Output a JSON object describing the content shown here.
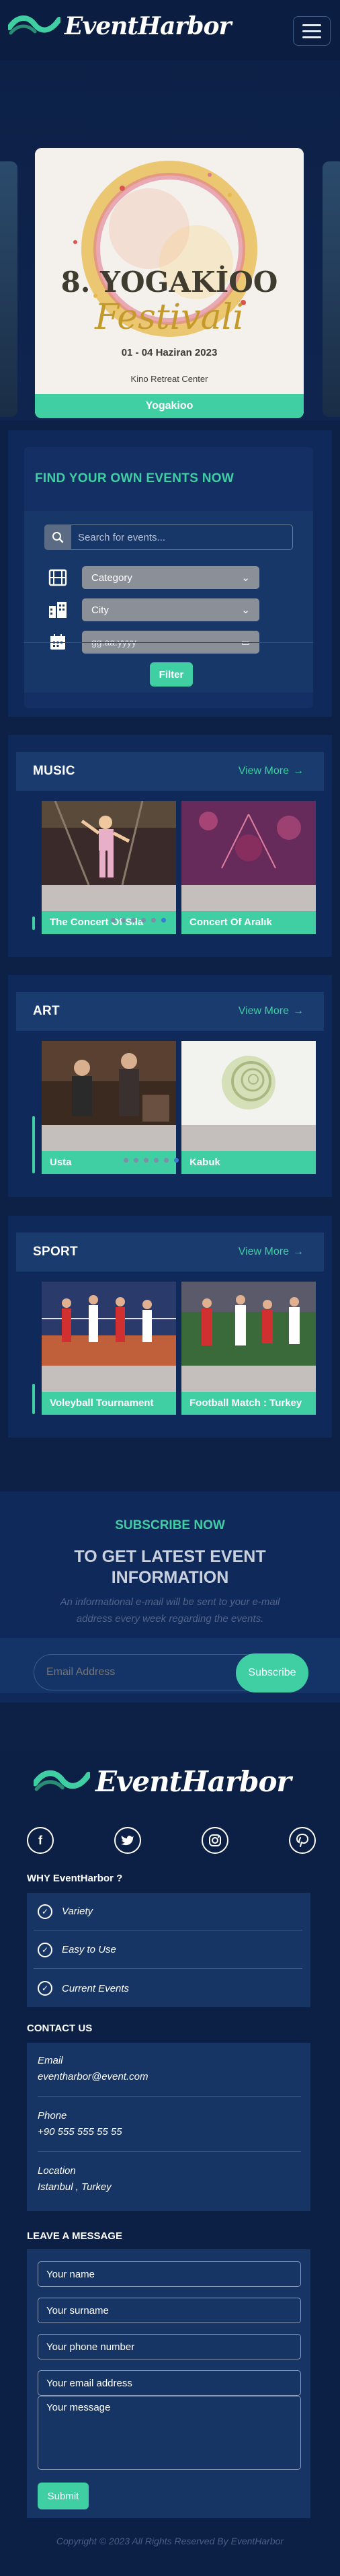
{
  "header": {
    "brand": "EventHarbor",
    "menu_icon": "hamburger-icon"
  },
  "hero": {
    "poster_title": "8. YOGAKİOO",
    "poster_subtitle": "Festivali",
    "poster_date": "01 - 04 Haziran 2023",
    "poster_venue": "Kino Retreat Center",
    "caption": "Yogakioo",
    "active_slide": 1
  },
  "search": {
    "title": "FIND YOUR OWN EVENTS NOW",
    "placeholder": "Search for events...",
    "category_label": "Category",
    "city_label": "City",
    "date_placeholder": "gg.aa.yyyy",
    "filter_button": "Filter"
  },
  "categories": [
    {
      "title": "MUSIC",
      "view_more": "View More",
      "events": [
        {
          "caption": "The Concert Of Sıla"
        },
        {
          "caption": "Concert Of Aralık"
        }
      ]
    },
    {
      "title": "ART",
      "view_more": "View More",
      "events": [
        {
          "caption": "Usta"
        },
        {
          "caption": "Kabuk"
        }
      ]
    },
    {
      "title": "SPORT",
      "view_more": "View More",
      "events": [
        {
          "caption": "Voleyball Tournament"
        },
        {
          "caption": "Football Match : Turkey"
        }
      ]
    }
  ],
  "subscribe": {
    "title": "SUBSCRIBE NOW",
    "headline": "TO GET LATEST EVENT INFORMATION",
    "description": "An informational e-mail will be sent to your e-mail address every week regarding the events.",
    "email_placeholder": "Email Address",
    "button": "Subscribe"
  },
  "footer": {
    "brand": "EventHarbor",
    "social": [
      "facebook-icon",
      "twitter-icon",
      "instagram-icon",
      "pinterest-icon"
    ],
    "why_heading": "WHY EventHarbor ?",
    "why_items": [
      "Variety",
      "Easy to Use",
      "Current Events"
    ],
    "contact_heading": "CONTACT US",
    "contact": [
      {
        "label": "Email",
        "value": "eventharbor@event.com"
      },
      {
        "label": "Phone",
        "value": "+90 555 555 55 55"
      },
      {
        "label": "Location",
        "value": "Istanbul , Turkey"
      }
    ],
    "message_heading": "LEAVE A MESSAGE",
    "form": {
      "name": "Your name",
      "surname": "Your surname",
      "phone": "Your phone number",
      "email": "Your email address",
      "message": "Your message",
      "submit": "Submit"
    },
    "copyright": "Copyright © 2023 All Rights Reserved By EventHarbor"
  },
  "colors": {
    "accent": "#3fcfa2",
    "background": "#0d2147",
    "panel": "#0f2a5a"
  }
}
